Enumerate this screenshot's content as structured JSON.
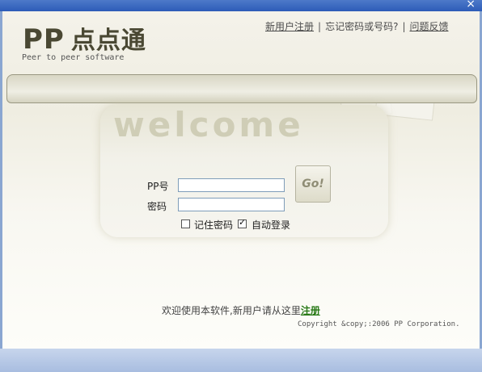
{
  "window": {
    "close_glyph": "×"
  },
  "logo": {
    "pp": "PP",
    "name": "点点通",
    "slogan": "Peer to peer software"
  },
  "toplinks": {
    "new_user": "新用户注册",
    "forgot": "忘记密码或号码?",
    "feedback": "问题反馈",
    "separator": "|"
  },
  "banner": {
    "welcome": "welcome"
  },
  "login": {
    "pp_label": "PP号",
    "password_label": "密码",
    "pp_value": "",
    "password_value": "",
    "go_label": "Go!",
    "remember_label": "记住密码",
    "remember_checked": false,
    "autologin_label": "自动登录",
    "autologin_checked": true
  },
  "footer": {
    "message": "欢迎使用本软件,新用户请从这里",
    "register": "注册",
    "copyright": "Copyright &copy;:2006 PP Corporation."
  },
  "colors": {
    "title_bar": "#2d5cb8",
    "logo_text": "#4a4833",
    "register_link": "#2a7a18"
  }
}
